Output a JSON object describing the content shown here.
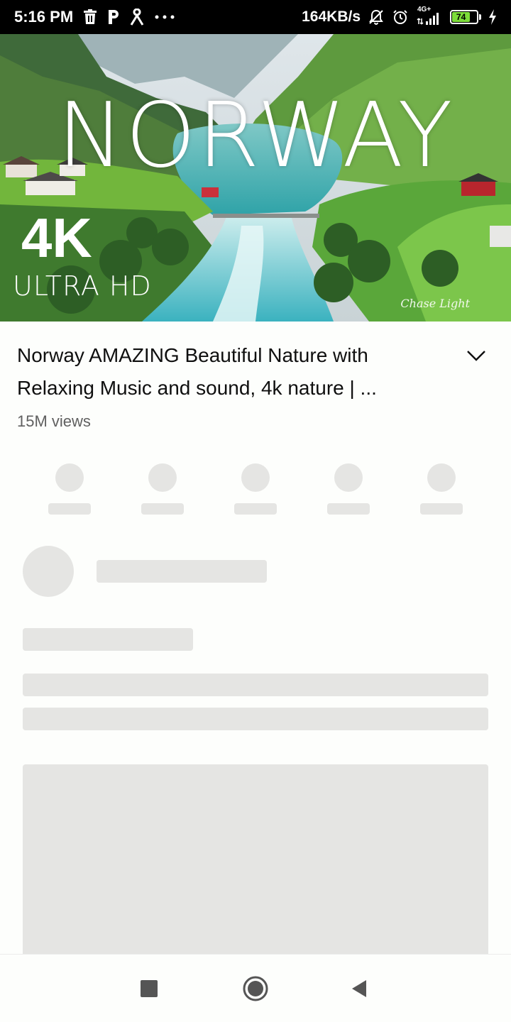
{
  "status_bar": {
    "time": "5:16 PM",
    "network_speed": "164KB/s",
    "network_type": "4G+",
    "battery_level": "74",
    "left_icons": [
      "trash-icon",
      "parking-icon",
      "person-icon",
      "more-dots-icon"
    ],
    "right_icons": [
      "mute-bell-icon",
      "alarm-icon",
      "signal-icon",
      "battery-icon",
      "charging-icon"
    ]
  },
  "thumbnail": {
    "title_text": "NORWAY",
    "quality_badge": "4K",
    "quality_label": "ULTRA HD",
    "signature": "Chase Light"
  },
  "video": {
    "title": "Norway AMAZING Beautiful Nature with Relaxing Music and sound, 4k nature | ...",
    "views": "15M views"
  },
  "colors": {
    "background": "#fdfefc",
    "skeleton": "#e5e5e3",
    "title_text": "#0f0f0f",
    "meta_text": "#606060"
  },
  "nav_bar": {
    "buttons": [
      "recents-square-icon",
      "home-circle-icon",
      "back-triangle-icon"
    ]
  }
}
